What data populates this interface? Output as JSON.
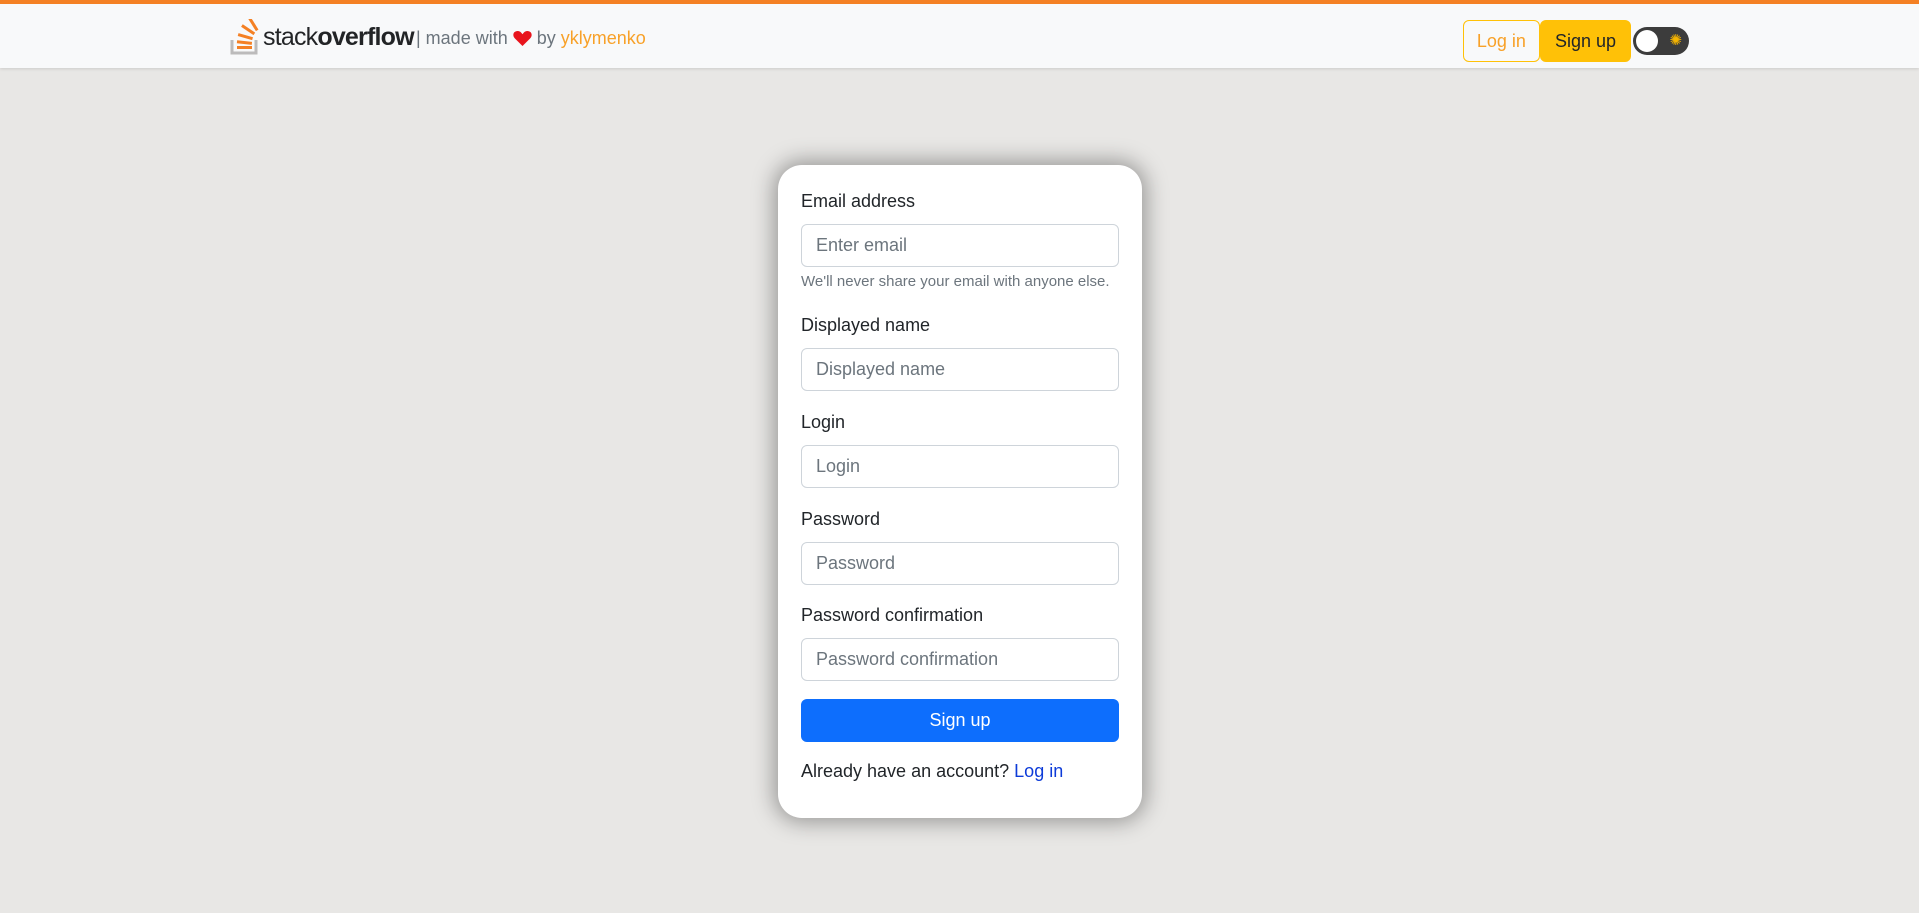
{
  "brand": {
    "logo_icon": "stackoverflow-logo-icon",
    "logo_light": "stack",
    "logo_bold": "overflow"
  },
  "credits": {
    "prefix": "| made with",
    "heart_icon": "heart-icon",
    "by": "by",
    "author": "yklymenko"
  },
  "nav": {
    "login_label": "Log in",
    "signup_label": "Sign up",
    "theme_toggle_icon": "sun-icon"
  },
  "form": {
    "email": {
      "label": "Email address",
      "placeholder": "Enter email",
      "value": "",
      "help": "We'll never share your email with anyone else."
    },
    "displayed_name": {
      "label": "Displayed name",
      "placeholder": "Displayed name",
      "value": ""
    },
    "login": {
      "label": "Login",
      "placeholder": "Login",
      "value": ""
    },
    "password": {
      "label": "Password",
      "placeholder": "Password",
      "value": ""
    },
    "password_confirmation": {
      "label": "Password confirmation",
      "placeholder": "Password confirmation",
      "value": ""
    },
    "submit_label": "Sign up",
    "footer_text": "Already have an account?",
    "footer_link": "Log in"
  },
  "colors": {
    "accent_stripe": "#f48024",
    "brand_orange": "#f8a128",
    "warning": "#ffc107",
    "primary": "#0d6efd",
    "page_bg": "#e8e7e5"
  }
}
